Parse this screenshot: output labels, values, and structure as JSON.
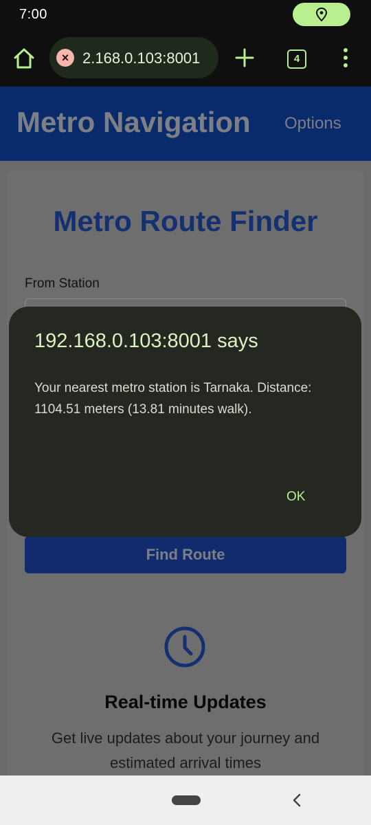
{
  "status_bar": {
    "time": "7:00",
    "location_icon": "location-pin-icon"
  },
  "browser": {
    "url": "2.168.0.103:8001",
    "tab_count": "4",
    "icons": {
      "home": "home-icon",
      "error": "close-icon",
      "new_tab": "plus-icon",
      "menu": "more-vertical-icon"
    },
    "accent_color": "#b9ef8e"
  },
  "page": {
    "brand": "Metro Navigation",
    "options": "Options",
    "title": "Metro Route Finder",
    "from_label": "From Station",
    "find_route": "Find Route",
    "feature_icon": "clock-icon",
    "feature_title": "Real-time Updates",
    "feature_desc": "Get live updates about your journey and estimated arrival times",
    "brand_color": "#0a2b6b"
  },
  "dialog": {
    "title": "192.168.0.103:8001 says",
    "message": "Your nearest metro station is Tarnaka. Distance: 1104.51 meters (13.81 minutes walk).",
    "ok": "OK"
  }
}
